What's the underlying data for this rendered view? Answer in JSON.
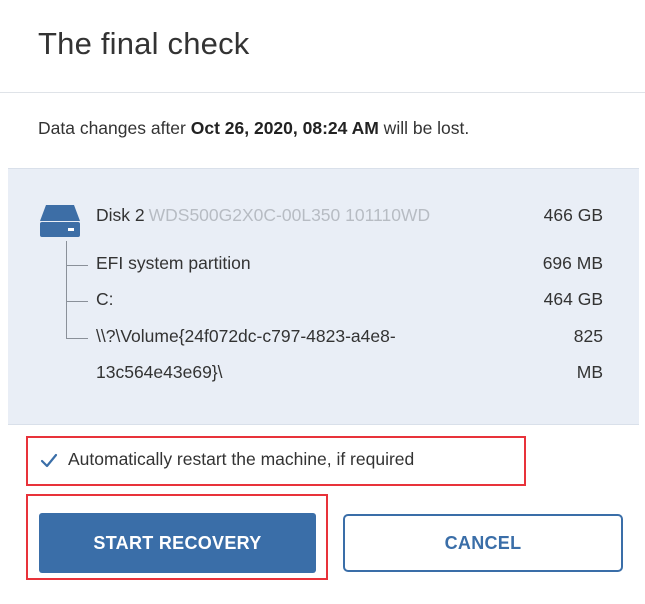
{
  "dialog": {
    "title": "The final check",
    "info_prefix": "Data changes after ",
    "info_date": "Oct 26, 2020, 08:24 AM",
    "info_suffix": " will be lost."
  },
  "disk": {
    "icon": "hard-drive-icon",
    "name": "Disk 2",
    "model": "WDS500G2X0C-00L350 101110WD",
    "size": "466 GB",
    "partitions": [
      {
        "name": "EFI system partition",
        "size": "696 MB"
      },
      {
        "name": "C:",
        "size": "464 GB"
      },
      {
        "name_line1": "\\\\?\\Volume{24f072dc-c797-4823-a4e8-",
        "name_line2": "13c564e43e69}\\",
        "size_line1": "825",
        "size_line2": "MB"
      }
    ]
  },
  "options": {
    "auto_restart_label": "Automatically restart the machine, if required",
    "auto_restart_checked": true
  },
  "buttons": {
    "start_label": "START RECOVERY",
    "cancel_label": "CANCEL"
  },
  "colors": {
    "accent": "#3a6ea8",
    "panel_bg": "#e9eef6",
    "highlight": "#e8323a"
  }
}
